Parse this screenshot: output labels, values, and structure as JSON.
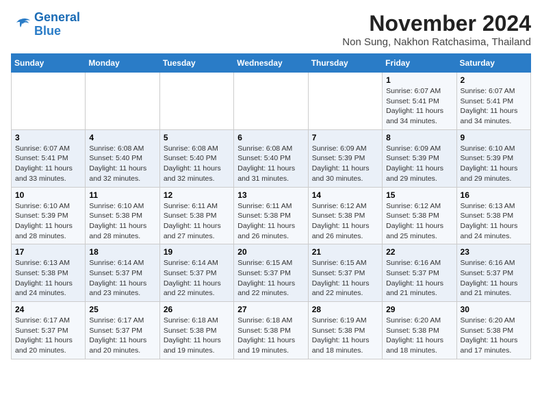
{
  "logo": {
    "line1": "General",
    "line2": "Blue"
  },
  "title": "November 2024",
  "location": "Non Sung, Nakhon Ratchasima, Thailand",
  "weekdays": [
    "Sunday",
    "Monday",
    "Tuesday",
    "Wednesday",
    "Thursday",
    "Friday",
    "Saturday"
  ],
  "weeks": [
    [
      {
        "day": "",
        "info": ""
      },
      {
        "day": "",
        "info": ""
      },
      {
        "day": "",
        "info": ""
      },
      {
        "day": "",
        "info": ""
      },
      {
        "day": "",
        "info": ""
      },
      {
        "day": "1",
        "info": "Sunrise: 6:07 AM\nSunset: 5:41 PM\nDaylight: 11 hours and 34 minutes."
      },
      {
        "day": "2",
        "info": "Sunrise: 6:07 AM\nSunset: 5:41 PM\nDaylight: 11 hours and 34 minutes."
      }
    ],
    [
      {
        "day": "3",
        "info": "Sunrise: 6:07 AM\nSunset: 5:41 PM\nDaylight: 11 hours and 33 minutes."
      },
      {
        "day": "4",
        "info": "Sunrise: 6:08 AM\nSunset: 5:40 PM\nDaylight: 11 hours and 32 minutes."
      },
      {
        "day": "5",
        "info": "Sunrise: 6:08 AM\nSunset: 5:40 PM\nDaylight: 11 hours and 32 minutes."
      },
      {
        "day": "6",
        "info": "Sunrise: 6:08 AM\nSunset: 5:40 PM\nDaylight: 11 hours and 31 minutes."
      },
      {
        "day": "7",
        "info": "Sunrise: 6:09 AM\nSunset: 5:39 PM\nDaylight: 11 hours and 30 minutes."
      },
      {
        "day": "8",
        "info": "Sunrise: 6:09 AM\nSunset: 5:39 PM\nDaylight: 11 hours and 29 minutes."
      },
      {
        "day": "9",
        "info": "Sunrise: 6:10 AM\nSunset: 5:39 PM\nDaylight: 11 hours and 29 minutes."
      }
    ],
    [
      {
        "day": "10",
        "info": "Sunrise: 6:10 AM\nSunset: 5:39 PM\nDaylight: 11 hours and 28 minutes."
      },
      {
        "day": "11",
        "info": "Sunrise: 6:10 AM\nSunset: 5:38 PM\nDaylight: 11 hours and 28 minutes."
      },
      {
        "day": "12",
        "info": "Sunrise: 6:11 AM\nSunset: 5:38 PM\nDaylight: 11 hours and 27 minutes."
      },
      {
        "day": "13",
        "info": "Sunrise: 6:11 AM\nSunset: 5:38 PM\nDaylight: 11 hours and 26 minutes."
      },
      {
        "day": "14",
        "info": "Sunrise: 6:12 AM\nSunset: 5:38 PM\nDaylight: 11 hours and 26 minutes."
      },
      {
        "day": "15",
        "info": "Sunrise: 6:12 AM\nSunset: 5:38 PM\nDaylight: 11 hours and 25 minutes."
      },
      {
        "day": "16",
        "info": "Sunrise: 6:13 AM\nSunset: 5:38 PM\nDaylight: 11 hours and 24 minutes."
      }
    ],
    [
      {
        "day": "17",
        "info": "Sunrise: 6:13 AM\nSunset: 5:38 PM\nDaylight: 11 hours and 24 minutes."
      },
      {
        "day": "18",
        "info": "Sunrise: 6:14 AM\nSunset: 5:37 PM\nDaylight: 11 hours and 23 minutes."
      },
      {
        "day": "19",
        "info": "Sunrise: 6:14 AM\nSunset: 5:37 PM\nDaylight: 11 hours and 22 minutes."
      },
      {
        "day": "20",
        "info": "Sunrise: 6:15 AM\nSunset: 5:37 PM\nDaylight: 11 hours and 22 minutes."
      },
      {
        "day": "21",
        "info": "Sunrise: 6:15 AM\nSunset: 5:37 PM\nDaylight: 11 hours and 22 minutes."
      },
      {
        "day": "22",
        "info": "Sunrise: 6:16 AM\nSunset: 5:37 PM\nDaylight: 11 hours and 21 minutes."
      },
      {
        "day": "23",
        "info": "Sunrise: 6:16 AM\nSunset: 5:37 PM\nDaylight: 11 hours and 21 minutes."
      }
    ],
    [
      {
        "day": "24",
        "info": "Sunrise: 6:17 AM\nSunset: 5:37 PM\nDaylight: 11 hours and 20 minutes."
      },
      {
        "day": "25",
        "info": "Sunrise: 6:17 AM\nSunset: 5:37 PM\nDaylight: 11 hours and 20 minutes."
      },
      {
        "day": "26",
        "info": "Sunrise: 6:18 AM\nSunset: 5:38 PM\nDaylight: 11 hours and 19 minutes."
      },
      {
        "day": "27",
        "info": "Sunrise: 6:18 AM\nSunset: 5:38 PM\nDaylight: 11 hours and 19 minutes."
      },
      {
        "day": "28",
        "info": "Sunrise: 6:19 AM\nSunset: 5:38 PM\nDaylight: 11 hours and 18 minutes."
      },
      {
        "day": "29",
        "info": "Sunrise: 6:20 AM\nSunset: 5:38 PM\nDaylight: 11 hours and 18 minutes."
      },
      {
        "day": "30",
        "info": "Sunrise: 6:20 AM\nSunset: 5:38 PM\nDaylight: 11 hours and 17 minutes."
      }
    ]
  ]
}
